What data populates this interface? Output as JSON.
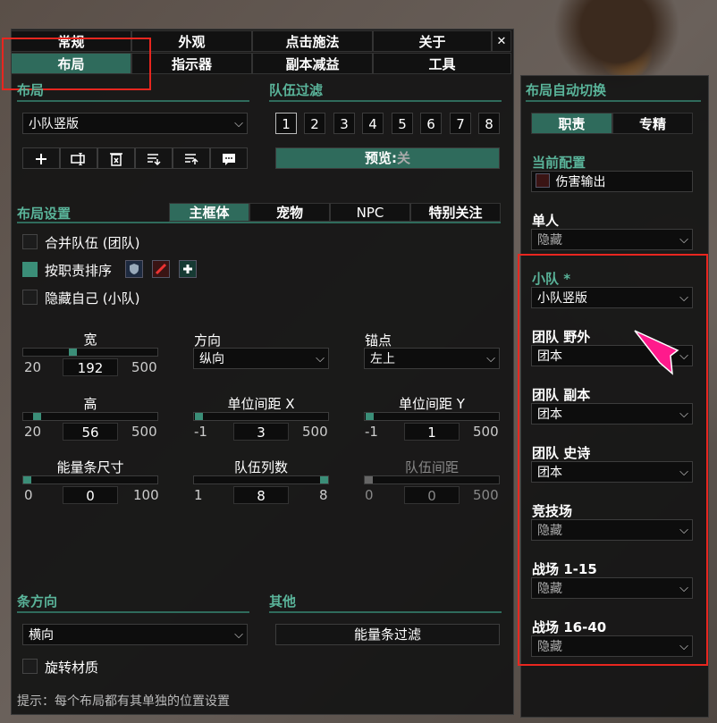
{
  "tabs_row1": [
    "常规",
    "外观",
    "点击施法",
    "关于"
  ],
  "tabs_row2": [
    "布局",
    "指示器",
    "副本减益",
    "工具"
  ],
  "close_glyph": "✕",
  "layout": {
    "title": "布局",
    "selected_layout": "小队竖版",
    "toolbar_icons": [
      "plus-icon",
      "rename-icon",
      "delete-icon",
      "import-icon",
      "export-icon",
      "more-icon"
    ]
  },
  "group_filter": {
    "title": "队伍过滤",
    "groups": [
      "1",
      "2",
      "3",
      "4",
      "5",
      "6",
      "7",
      "8"
    ],
    "preview_label": "预览:",
    "preview_state": "关"
  },
  "layout_settings": {
    "title": "布局设置",
    "subtabs": [
      "主框体",
      "宠物",
      "NPC",
      "特别关注"
    ],
    "merge_groups": "合并队伍 (团队)",
    "sort_by_role": "按职责排序",
    "hide_self": "隐藏自己 (小队)",
    "width": {
      "label": "宽",
      "min": "20",
      "value": "192",
      "max": "500",
      "fraction": 0.36
    },
    "height": {
      "label": "高",
      "min": "20",
      "value": "56",
      "max": "500",
      "fraction": 0.075
    },
    "direction": {
      "label": "方向",
      "value": "纵向"
    },
    "anchor": {
      "label": "锚点",
      "value": "左上"
    },
    "spacing_x": {
      "label": "单位间距 X",
      "min": "-1",
      "value": "3",
      "max": "500",
      "fraction": 0.008
    },
    "spacing_y": {
      "label": "单位间距 Y",
      "min": "-1",
      "value": "1",
      "max": "500",
      "fraction": 0.004
    },
    "power_size": {
      "label": "能量条尺寸",
      "min": "0",
      "value": "0",
      "max": "100",
      "fraction": 0
    },
    "group_columns": {
      "label": "队伍列数",
      "min": "1",
      "value": "8",
      "max": "8",
      "fraction": 1
    },
    "group_spacing": {
      "label": "队伍间距",
      "min": "0",
      "value": "0",
      "max": "500",
      "fraction": 0
    }
  },
  "bar_direction": {
    "title": "条方向",
    "value": "横向",
    "rotate": "旋转材质"
  },
  "other": {
    "title": "其他",
    "power_filter": "能量条过滤"
  },
  "hint": "提示：每个布局都有其单独的位置设置",
  "auto_switch": {
    "title": "布局自动切换",
    "tabs": [
      "职责",
      "专精"
    ],
    "current_config_label": "当前配置",
    "current_config_value": "伤害输出",
    "rows": [
      {
        "label": "单人",
        "value": "隐藏"
      },
      {
        "label": "小队 *",
        "value": "小队竖版"
      },
      {
        "label": "团队 野外",
        "value": "团本"
      },
      {
        "label": "团队 副本",
        "value": "团本"
      },
      {
        "label": "团队 史诗",
        "value": "团本"
      },
      {
        "label": "竞技场",
        "value": "隐藏"
      },
      {
        "label": "战场 1-15",
        "value": "隐藏"
      },
      {
        "label": "战场 16-40",
        "value": "隐藏"
      }
    ]
  },
  "colors": {
    "accent": "#3b8e78",
    "heading": "#5ab49a",
    "highlight_box": "#e8261f",
    "pointer": "#ff1a8c"
  }
}
